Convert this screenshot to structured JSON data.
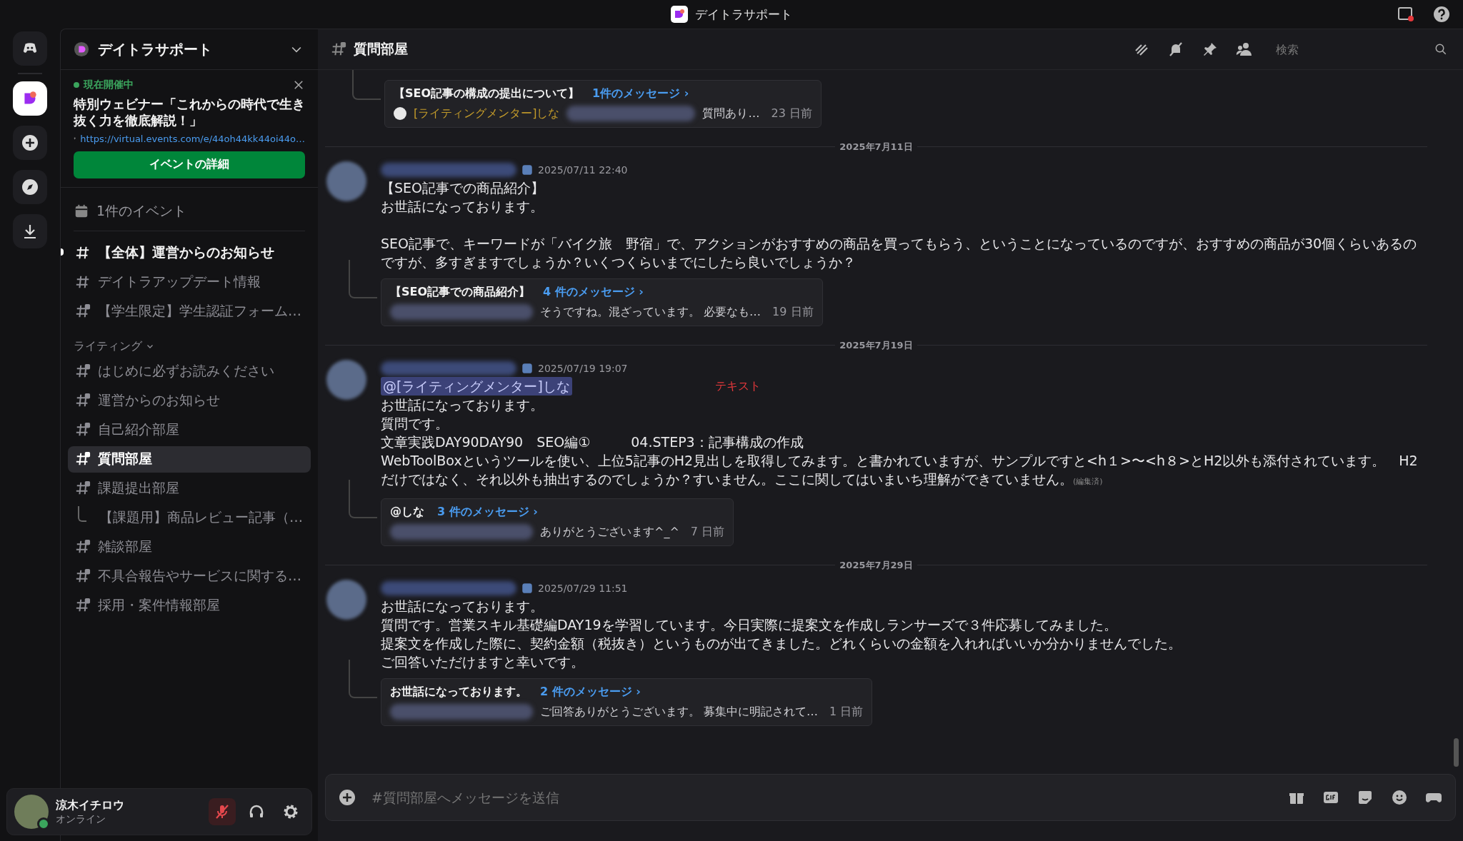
{
  "window": {
    "title": "デイトラサポート"
  },
  "server": {
    "name": "デイトラサポート"
  },
  "event_banner": {
    "status": "現在開催中",
    "title": "特別ウェビナー「これからの時代で生き抜く力を徹底解説！」",
    "url": "https://virtual.events.com/e/44oh44kk44oi44o…",
    "button": "イベントの詳細"
  },
  "events_link": "1件のイベント",
  "channels": [
    {
      "name": "【全体】運営からのお知らせ",
      "kind": "text",
      "unread": true,
      "selected": false
    },
    {
      "name": "デイトラアップデート情報",
      "kind": "text",
      "unread": false,
      "selected": false
    },
    {
      "name": "【学生限定】学生認証フォーム…",
      "kind": "locked",
      "unread": false,
      "selected": false
    }
  ],
  "categories": [
    {
      "name": "ライティング",
      "expanded": true,
      "channels": [
        {
          "name": "はじめに必ずお読みください",
          "kind": "locked",
          "unread": false,
          "selected": false
        },
        {
          "name": "運営からのお知らせ",
          "kind": "locked",
          "unread": false,
          "selected": false
        },
        {
          "name": "自己紹介部屋",
          "kind": "locked",
          "unread": false,
          "selected": false
        },
        {
          "name": "質問部屋",
          "kind": "locked",
          "unread": false,
          "selected": true
        },
        {
          "name": "課題提出部屋",
          "kind": "locked",
          "unread": false,
          "selected": false,
          "children": [
            {
              "name": "【課題用】商品レビュー記事（…",
              "selected": false
            }
          ]
        },
        {
          "name": "雑談部屋",
          "kind": "locked",
          "unread": false,
          "selected": false
        },
        {
          "name": "不具合報告やサービスに関する…",
          "kind": "locked",
          "unread": false,
          "selected": false
        },
        {
          "name": "採用・案件情報部屋",
          "kind": "locked",
          "unread": false,
          "selected": false
        }
      ]
    }
  ],
  "user": {
    "name": "涼木イチロウ",
    "status": "オンライン",
    "muted": true
  },
  "header": {
    "channel": "質問部屋",
    "search_placeholder": "検索"
  },
  "feed": [
    {
      "kind": "thread",
      "title": "【SEO記事の構成の提出について】",
      "count": "1件のメッセージ ›",
      "author": "[ライティングメンター]しな",
      "preview": "質問あり…",
      "ago": "23 日前"
    },
    {
      "kind": "divider",
      "date": "2025年7月11日"
    },
    {
      "kind": "message",
      "time": "2025/07/11 22:40",
      "paragraphs": [
        [
          "【SEO記事での商品紹介】",
          "お世話になっております。"
        ],
        [
          "SEO記事で、キーワードが「バイク旅　野宿」で、アクションがおすすめの商品を買ってもらう、ということになっているのですが、おすすめの商品が30個くらいあるのですが、多すぎますでしょうか？いくつくらいまでにしたら良いでしょうか？"
        ]
      ],
      "thread": {
        "title": "【SEO記事での商品紹介】",
        "count": "4 件のメッセージ ›",
        "preview": "そうですね。混ざっています。 必要なも…",
        "ago": "19 日前"
      }
    },
    {
      "kind": "divider",
      "date": "2025年7月19日"
    },
    {
      "kind": "message",
      "time": "2025/07/19 19:07",
      "mention": "@[ライティングメンター]しな",
      "annotation": "テキスト",
      "paragraphs": [
        [
          "お世話になっております。",
          "質問です。",
          "文章実践DAY90DAY90　SEO編①　　　04.STEP3：記事構成の作成",
          "WebToolBoxというツールを使い、上位5記事のH2見出しを取得してみます。と書かれていますが、サンプルですと<h１>〜<h８>とH2以外も添付されています。　H2だけではなく、それ以外も抽出するのでしょうか？すいません。ここに関してはいまいち理解ができていません。"
        ]
      ],
      "edited": "(編集済)",
      "thread": {
        "title": "@しな",
        "count": "3 件のメッセージ ›",
        "preview": "ありがとうございます^_^",
        "ago": "7 日前"
      }
    },
    {
      "kind": "divider",
      "date": "2025年7月29日"
    },
    {
      "kind": "message",
      "time": "2025/07/29 11:51",
      "paragraphs": [
        [
          "お世話になっております。",
          "質問です。営業スキル基礎編DAY19を学習しています。今日実際に提案文を作成しランサーズで３件応募してみました。",
          "提案文を作成した際に、契約金額（税抜き）というものが出てきました。どれくらいの金額を入れればいいか分かりませんでした。",
          "ご回答いただけますと幸いです。"
        ]
      ],
      "thread": {
        "title": "お世話になっております。",
        "count": "2 件のメッセージ ›",
        "preview": "ご回答ありがとうございます。 募集中に明記されて…",
        "ago": "1 日前"
      }
    }
  ],
  "composer": {
    "placeholder": "#質問部屋へメッセージを送信"
  }
}
